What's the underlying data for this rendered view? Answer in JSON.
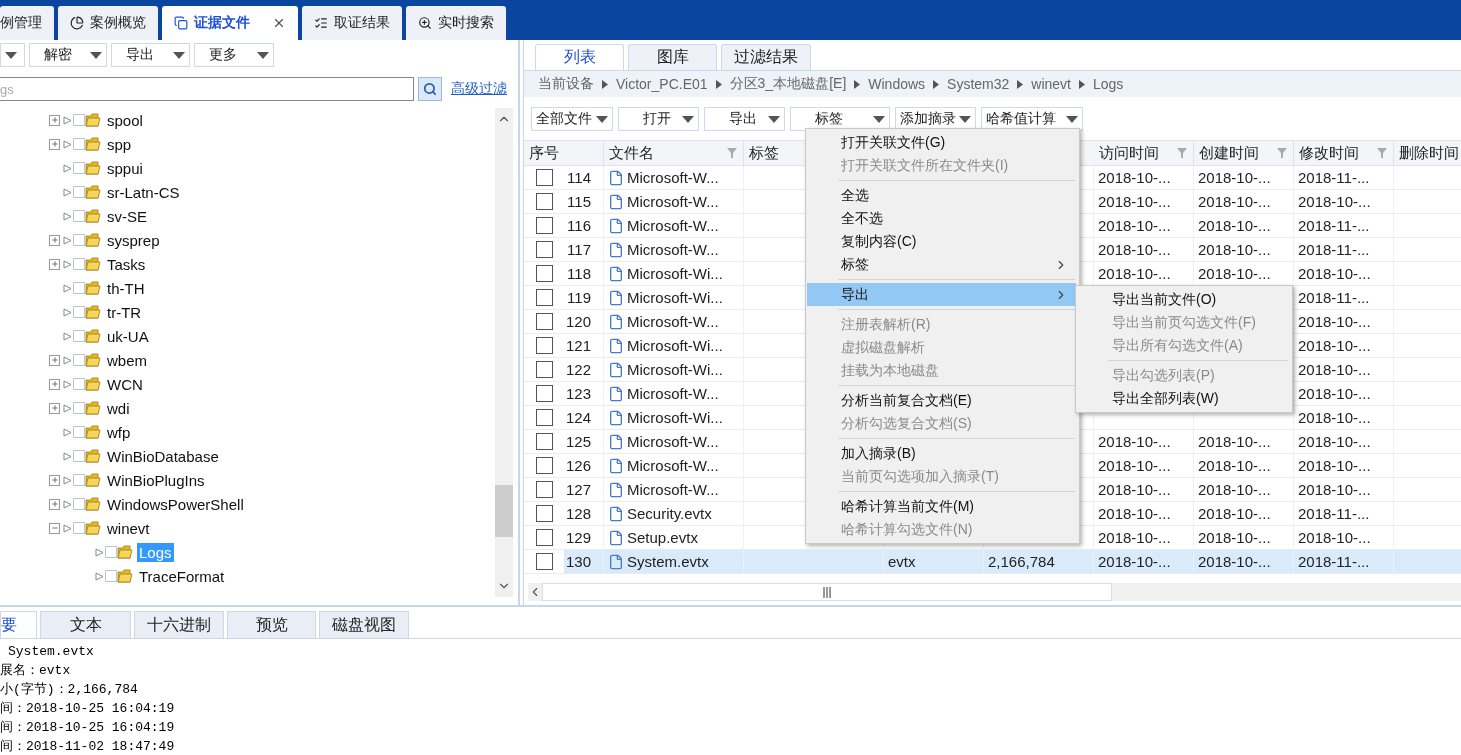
{
  "top_tabs": [
    {
      "label": "例管理",
      "kind": "plain",
      "selected": false,
      "closable": false
    },
    {
      "label": "案例概览",
      "kind": "overview",
      "selected": false,
      "closable": false
    },
    {
      "label": "证据文件",
      "kind": "evidence",
      "selected": true,
      "closable": true
    },
    {
      "label": "取证结果",
      "kind": "results",
      "selected": false,
      "closable": false
    },
    {
      "label": "实时搜索",
      "kind": "search",
      "selected": false,
      "closable": false
    }
  ],
  "left_toolbar": {
    "cut_button": true,
    "buttons": [
      "解密",
      "导出",
      "更多"
    ]
  },
  "search": {
    "placeholder": "gs",
    "link": "高级过滤"
  },
  "tree": [
    {
      "label": "spool",
      "kind": "branch",
      "expanded": false,
      "checked": false,
      "selected": false
    },
    {
      "label": "spp",
      "kind": "branch",
      "expanded": false,
      "checked": false,
      "selected": false
    },
    {
      "label": "sppui",
      "kind": "leaf",
      "checked": false,
      "selected": false
    },
    {
      "label": "sr-Latn-CS",
      "kind": "leaf",
      "checked": false,
      "selected": false
    },
    {
      "label": "sv-SE",
      "kind": "leaf",
      "checked": false,
      "selected": false
    },
    {
      "label": "sysprep",
      "kind": "branch",
      "expanded": false,
      "checked": false,
      "selected": false
    },
    {
      "label": "Tasks",
      "kind": "branch",
      "expanded": false,
      "checked": false,
      "selected": false
    },
    {
      "label": "th-TH",
      "kind": "leaf",
      "checked": false,
      "selected": false
    },
    {
      "label": "tr-TR",
      "kind": "leaf",
      "checked": false,
      "selected": false
    },
    {
      "label": "uk-UA",
      "kind": "leaf",
      "checked": false,
      "selected": false
    },
    {
      "label": "wbem",
      "kind": "branch",
      "expanded": false,
      "checked": false,
      "selected": false
    },
    {
      "label": "WCN",
      "kind": "branch",
      "expanded": false,
      "checked": false,
      "selected": false
    },
    {
      "label": "wdi",
      "kind": "branch",
      "expanded": false,
      "checked": false,
      "selected": false
    },
    {
      "label": "wfp",
      "kind": "leaf",
      "checked": false,
      "selected": false
    },
    {
      "label": "WinBioDatabase",
      "kind": "leaf",
      "checked": false,
      "selected": false
    },
    {
      "label": "WinBioPlugIns",
      "kind": "branch",
      "expanded": false,
      "checked": false,
      "selected": false
    },
    {
      "label": "WindowsPowerShell",
      "kind": "branch",
      "expanded": false,
      "checked": false,
      "selected": false
    },
    {
      "label": "winevt",
      "kind": "branch",
      "expanded": true,
      "checked": false,
      "selected": false,
      "children": [
        {
          "label": "Logs",
          "kind": "leaf",
          "checked": false,
          "selected": true
        },
        {
          "label": "TraceFormat",
          "kind": "leaf",
          "checked": false,
          "selected": false
        }
      ]
    }
  ],
  "view_tabs": [
    {
      "label": "列表",
      "selected": true
    },
    {
      "label": "图库",
      "selected": false
    },
    {
      "label": "过滤结果",
      "selected": false
    }
  ],
  "breadcrumb": [
    "当前设备",
    "Victor_PC.E01",
    "分区3_本地磁盘[E]",
    "Windows",
    "System32",
    "winevt",
    "Logs"
  ],
  "file_toolbar": [
    "全部文件",
    "打开",
    "导出",
    "标签",
    "添加摘录",
    "哈希值计算"
  ],
  "table": {
    "columns": [
      {
        "label": "序号",
        "filter": false
      },
      {
        "label": "文件名",
        "filter": true
      },
      {
        "label": "标签"
      },
      {
        "label": "访问时间",
        "filter": true
      },
      {
        "label": "创建时间",
        "filter": true
      },
      {
        "label": "修改时间",
        "filter": true
      },
      {
        "label": "删除时间"
      }
    ],
    "rows": [
      {
        "number": "114",
        "name": "Microsoft-W...",
        "access": "2018-10-...",
        "created": "2018-10-...",
        "modified": "2018-11-...",
        "checked": false,
        "selected": false
      },
      {
        "number": "115",
        "name": "Microsoft-W...",
        "access": "2018-10-...",
        "created": "2018-10-...",
        "modified": "2018-10-...",
        "checked": false,
        "selected": false
      },
      {
        "number": "116",
        "name": "Microsoft-W...",
        "access": "2018-10-...",
        "created": "2018-10-...",
        "modified": "2018-11-...",
        "checked": false,
        "selected": false
      },
      {
        "number": "117",
        "name": "Microsoft-W...",
        "access": "2018-10-...",
        "created": "2018-10-...",
        "modified": "2018-11-...",
        "checked": false,
        "selected": false
      },
      {
        "number": "118",
        "name": "Microsoft-Wi...",
        "access": "2018-10-...",
        "created": "2018-10-...",
        "modified": "2018-10-...",
        "checked": false,
        "selected": false
      },
      {
        "number": "119",
        "name": "Microsoft-Wi...",
        "modified": "2018-11-...",
        "checked": false,
        "selected": false
      },
      {
        "number": "120",
        "name": "Microsoft-W...",
        "modified": "2018-10-...",
        "checked": false,
        "selected": false
      },
      {
        "number": "121",
        "name": "Microsoft-Wi...",
        "modified": "2018-10-...",
        "checked": false,
        "selected": false
      },
      {
        "number": "122",
        "name": "Microsoft-Wi...",
        "modified": "2018-10-...",
        "checked": false,
        "selected": false
      },
      {
        "number": "123",
        "name": "Microsoft-W...",
        "modified": "2018-10-...",
        "checked": false,
        "selected": false
      },
      {
        "number": "124",
        "name": "Microsoft-Wi...",
        "modified": "2018-10-...",
        "checked": false,
        "selected": false
      },
      {
        "number": "125",
        "name": "Microsoft-W...",
        "access": "2018-10-...",
        "created": "2018-10-...",
        "modified": "2018-10-...",
        "checked": false,
        "selected": false
      },
      {
        "number": "126",
        "name": "Microsoft-W...",
        "access": "2018-10-...",
        "created": "2018-10-...",
        "modified": "2018-10-...",
        "checked": false,
        "selected": false
      },
      {
        "number": "127",
        "name": "Microsoft-W...",
        "access": "2018-10-...",
        "created": "2018-10-...",
        "modified": "2018-10-...",
        "checked": false,
        "selected": false
      },
      {
        "number": "128",
        "name": "Security.evtx",
        "access": "2018-10-...",
        "created": "2018-10-...",
        "modified": "2018-11-...",
        "checked": false,
        "selected": false
      },
      {
        "number": "129",
        "name": "Setup.evtx",
        "access": "2018-10-...",
        "created": "2018-10-...",
        "modified": "2018-10-...",
        "checked": false,
        "selected": false
      },
      {
        "number": "130",
        "name": "System.evtx",
        "type": "evtx",
        "size": "2,166,784",
        "access": "2018-10-...",
        "created": "2018-10-...",
        "modified": "2018-11-...",
        "checked": false,
        "selected": true
      }
    ]
  },
  "context_menu": [
    {
      "kind": "item",
      "label": "打开关联文件(G)",
      "disabled": false,
      "submenu": false,
      "highlighted": false
    },
    {
      "kind": "item",
      "label": "打开关联文件所在文件夹(I)",
      "disabled": true,
      "submenu": false,
      "highlighted": false
    },
    {
      "kind": "separator"
    },
    {
      "kind": "item",
      "label": "全选",
      "disabled": false,
      "submenu": false,
      "highlighted": false
    },
    {
      "kind": "item",
      "label": "全不选",
      "disabled": false,
      "submenu": false,
      "highlighted": false
    },
    {
      "kind": "item",
      "label": "复制内容(C)",
      "disabled": false,
      "submenu": false,
      "highlighted": false
    },
    {
      "kind": "item",
      "label": "标签",
      "disabled": false,
      "submenu": true,
      "highlighted": false
    },
    {
      "kind": "separator"
    },
    {
      "kind": "item",
      "label": "导出",
      "disabled": false,
      "submenu": true,
      "highlighted": true
    },
    {
      "kind": "separator"
    },
    {
      "kind": "item",
      "label": "注册表解析(R)",
      "disabled": true,
      "submenu": false,
      "highlighted": false
    },
    {
      "kind": "item",
      "label": "虚拟磁盘解析",
      "disabled": true,
      "submenu": false,
      "highlighted": false
    },
    {
      "kind": "item",
      "label": "挂载为本地磁盘",
      "disabled": true,
      "submenu": false,
      "highlighted": false
    },
    {
      "kind": "separator"
    },
    {
      "kind": "item",
      "label": "分析当前复合文档(E)",
      "disabled": false,
      "submenu": false,
      "highlighted": false
    },
    {
      "kind": "item",
      "label": "分析勾选复合文档(S)",
      "disabled": true,
      "submenu": false,
      "highlighted": false
    },
    {
      "kind": "separator"
    },
    {
      "kind": "item",
      "label": "加入摘录(B)",
      "disabled": false,
      "submenu": false,
      "highlighted": false
    },
    {
      "kind": "item",
      "label": "当前页勾选项加入摘录(T)",
      "disabled": true,
      "submenu": false,
      "highlighted": false
    },
    {
      "kind": "separator"
    },
    {
      "kind": "item",
      "label": "哈希计算当前文件(M)",
      "disabled": false,
      "submenu": false,
      "highlighted": false
    },
    {
      "kind": "item",
      "label": "哈希计算勾选文件(N)",
      "disabled": true,
      "submenu": false,
      "highlighted": false
    }
  ],
  "export_submenu": [
    {
      "kind": "item",
      "label": "导出当前文件(O)",
      "disabled": false
    },
    {
      "kind": "item",
      "label": "导出当前页勾选文件(F)",
      "disabled": true
    },
    {
      "kind": "item",
      "label": "导出所有勾选文件(A)",
      "disabled": true
    },
    {
      "kind": "separator"
    },
    {
      "kind": "item",
      "label": "导出勾选列表(P)",
      "disabled": true
    },
    {
      "kind": "item",
      "label": "导出全部列表(W)",
      "disabled": false
    }
  ],
  "detail_tabs": [
    {
      "label": "要",
      "selected": true
    },
    {
      "label": "文本",
      "selected": false
    },
    {
      "label": "十六进制",
      "selected": false
    },
    {
      "label": "预览",
      "selected": false
    },
    {
      "label": "磁盘视图",
      "selected": false
    }
  ],
  "detail_lines": [
    "System.evtx",
    "展名：evtx",
    "小(字节)：2,166,784",
    "间：2018-10-25 16:04:19",
    "间：2018-10-25 16:04:19",
    "间：2018-11-02 18:47:49"
  ]
}
